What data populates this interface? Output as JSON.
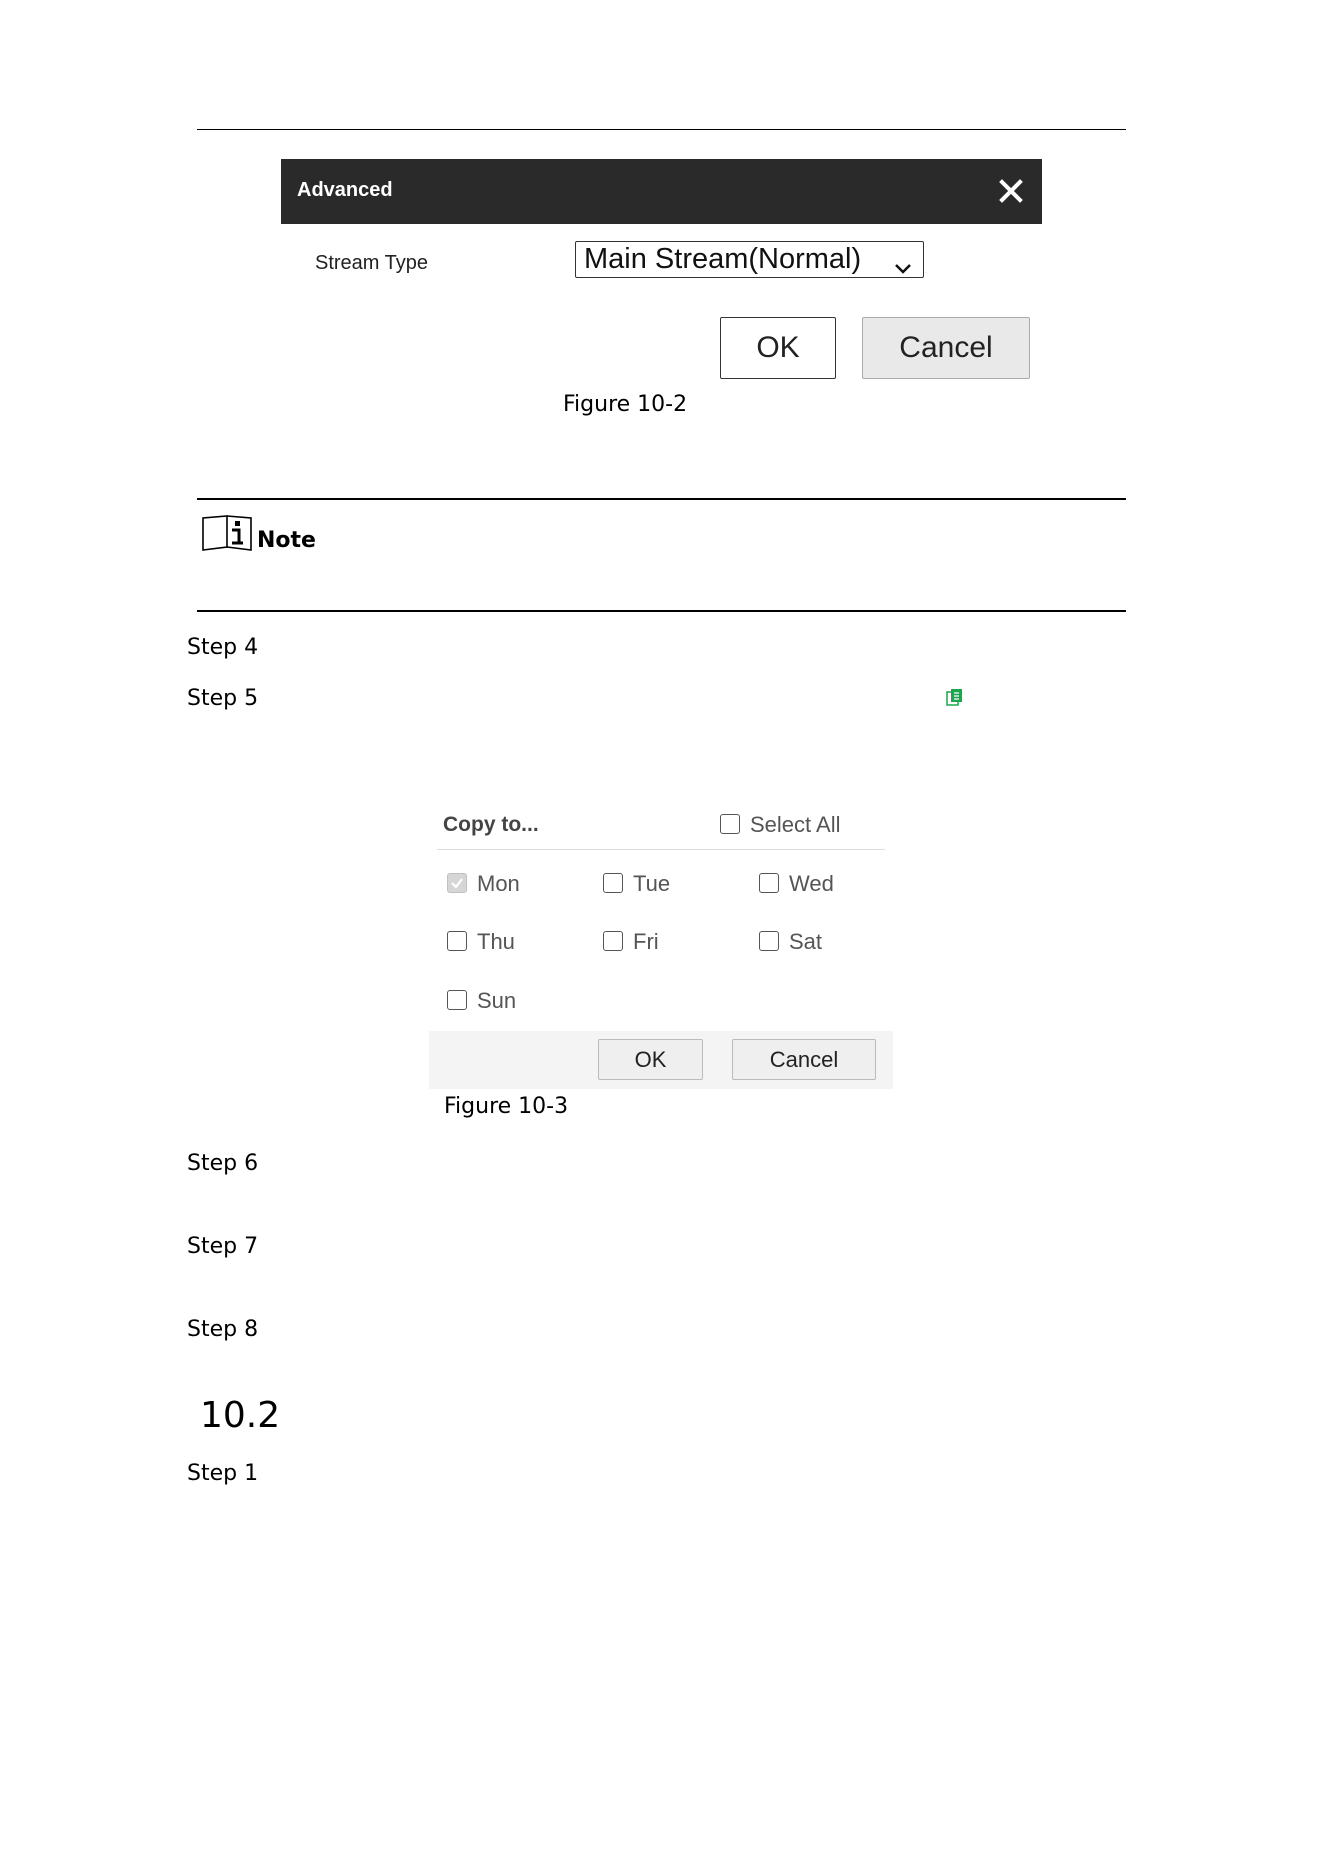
{
  "advanced_dialog": {
    "title": "Advanced",
    "close_icon": "close-icon",
    "stream_type_label": "Stream Type",
    "stream_type_value": "Main Stream(Normal)",
    "ok_label": "OK",
    "cancel_label": "Cancel"
  },
  "figure_10_2_caption": "Figure 10-2",
  "note": {
    "icon": "note-book-icon",
    "label": "Note"
  },
  "steps": {
    "step4": "Step 4",
    "step5": "Step 5",
    "step6": "Step 6",
    "step7": "Step 7",
    "step8": "Step 8",
    "step1": "Step 1"
  },
  "copy_icon": "copy-icon",
  "copy_dialog": {
    "title": "Copy to...",
    "select_all_label": "Select All",
    "days": [
      {
        "label": "Mon",
        "checked": true
      },
      {
        "label": "Tue",
        "checked": false
      },
      {
        "label": "Wed",
        "checked": false
      },
      {
        "label": "Thu",
        "checked": false
      },
      {
        "label": "Fri",
        "checked": false
      },
      {
        "label": "Sat",
        "checked": false
      },
      {
        "label": "Sun",
        "checked": false
      }
    ],
    "ok_label": "OK",
    "cancel_label": "Cancel"
  },
  "figure_10_3_caption": "Figure 10-3",
  "section_number": "10.2",
  "colors": {
    "dialog_header": "#2a2a2a",
    "copy_icon_green": "#1aa84f"
  }
}
